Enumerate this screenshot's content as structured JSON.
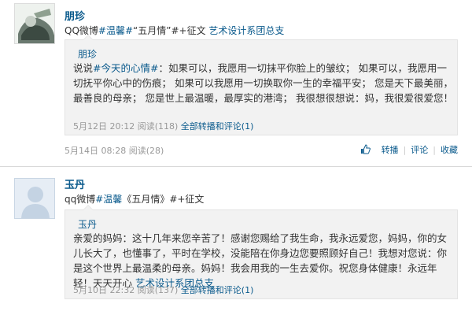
{
  "posts": [
    {
      "author": "朋珍",
      "content_prefix": "QQ微博",
      "content_tag": "#温馨#",
      "content_middle": "“五月情”#+征文 ",
      "content_link": "艺术设计系团总支",
      "quote": {
        "author": "朋珍",
        "tag": "说说#今天的心情#",
        "text": "：如果可以，我愿用一切抹平你脸上的皱纹；  如果可以，我愿用一切抚平你心中的伤痕；  如果可以我愿用一切换取你一生的幸福平安；  您是天下最美丽，最善良的母亲；  您是世上最温暖，最厚实的港湾；  我很想很想说：妈，我很爱很爱您！",
        "time": "5月12日 20:12",
        "views": "阅读(118)",
        "repost_link": "全部转播和评论(1)"
      },
      "footer": {
        "time": "5月14日 08:28 阅读(28)",
        "actions": [
          "转播",
          "评论",
          "收藏"
        ]
      }
    },
    {
      "author": "玉丹",
      "content_prefix": "qq微博",
      "content_tag": "#温馨",
      "content_middle": "《五月情》#+征文",
      "content_link": "",
      "quote": {
        "author": "玉丹",
        "text_main": "亲爱的妈妈：这十几年来您辛苦了！感谢您赐给了我生命，我永远爱您，妈妈，你的女儿长大了，也懂事了，平时在学校，没能陪在你身边您要照顾好自己！我想对您说：你是这个世界上最温柔的母亲。妈妈！我会用我的一生去爱你。祝您身体健康！永远年轻！天天开心 ",
        "text_link": "艺术设计系团总支",
        "time": "5月10日 22:32",
        "views": "阅读(137)",
        "repost_link": "全部转播和评论(1)"
      }
    }
  ],
  "colors": {
    "link": "#0a5a8c",
    "meta": "#999999",
    "quote_bg": "#f2f2f2"
  },
  "icons": {
    "like": "thumbs-up-icon"
  }
}
